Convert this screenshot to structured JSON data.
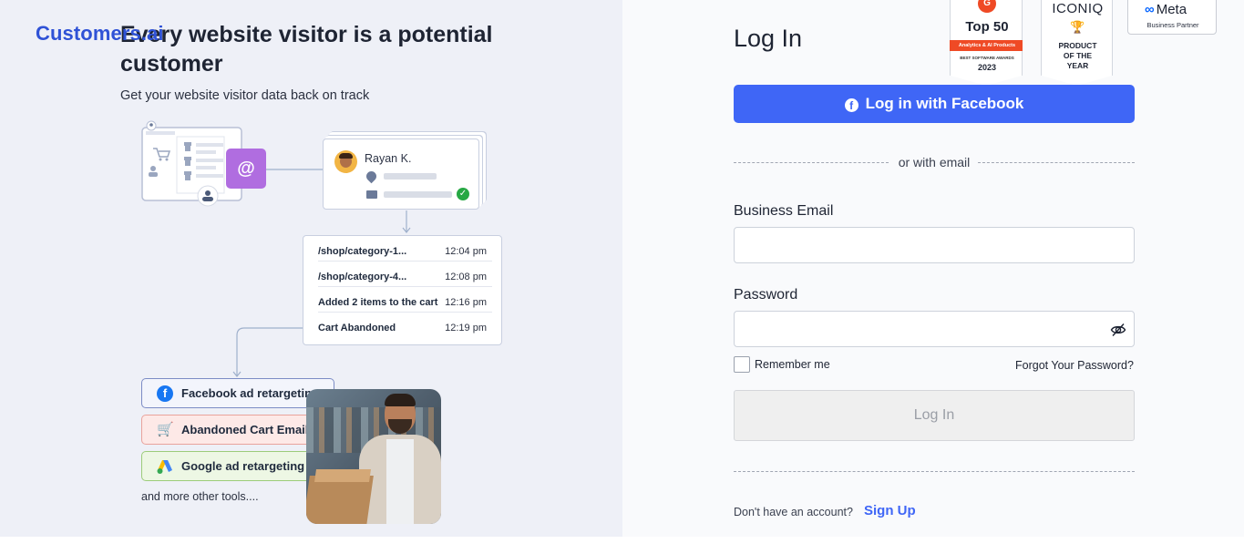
{
  "brand": {
    "name": "Customers.ai"
  },
  "hero": {
    "title": "Every website visitor is a potential customer",
    "subtitle": "Get your website visitor data back on track"
  },
  "illustration": {
    "at_symbol": "@",
    "profile": {
      "name": "Rayan K."
    },
    "activity": [
      {
        "path": "/shop/category-1...",
        "time": "12:04 pm"
      },
      {
        "path": "/shop/category-4...",
        "time": "12:08 pm"
      },
      {
        "path": "Added  2 items to the cart",
        "time": "12:16 pm"
      },
      {
        "path": "Cart Abandoned",
        "time": "12:19 pm"
      }
    ],
    "chips": {
      "facebook": "Facebook ad retargeting",
      "cart": "Abandoned Cart Email",
      "google": "Google ad retargeting"
    },
    "more_tools": "and more other tools...."
  },
  "badges": {
    "g2": {
      "logo": "G",
      "title": "Top 50",
      "category": "Analytics & AI Products",
      "award": "BEST SOFTWARE AWARDS",
      "year": "2023"
    },
    "iconiq": {
      "name": "ICONIQ",
      "award": "PRODUCT\nOF THE\nYEAR"
    },
    "meta": {
      "name": "Meta",
      "subtitle": "Business Partner"
    }
  },
  "login": {
    "title": "Log In",
    "facebook_button": "Log in with Facebook",
    "divider": "or with email",
    "email_label": "Business Email",
    "email_value": "",
    "password_label": "Password",
    "password_value": "",
    "remember_me": "Remember me",
    "forgot_password": "Forgot Your Password?",
    "submit_button": "Log In",
    "no_account": "Don't have an account?",
    "signup_link": "Sign Up"
  },
  "colors": {
    "brand": "#2f52d6",
    "primary_button": "#3f66f6",
    "left_bg": "#eef0f7",
    "right_bg": "#f9fafc",
    "g2_red": "#ef4a25"
  },
  "icons": {
    "facebook": "facebook-icon",
    "eye": "eye-slash-icon",
    "check": "check-icon",
    "cart": "cart-x-icon",
    "google_ads": "google-ads-icon"
  }
}
